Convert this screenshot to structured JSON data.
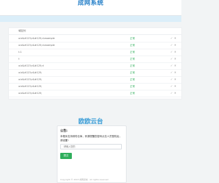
{
  "header": {
    "title": "成网系统"
  },
  "table": {
    "column_header": "域名列",
    "rows": [
      {
        "name": "a.b&#123;c&#125;d.example",
        "status": "正常",
        "actions": [
          "✓",
          "✕"
        ]
      },
      {
        "name": "a.b&#123;c&#125;d.example",
        "status": "正常",
        "actions": [
          "✓",
          "✕"
        ]
      },
      {
        "name": "t.1",
        "status": "正常",
        "actions": [
          "✓",
          "✕"
        ]
      },
      {
        "name": "t",
        "status": "正常",
        "actions": [
          "✓",
          "✕"
        ]
      },
      {
        "name": "a.b&#123;c&#125;d",
        "status": "正常",
        "actions": [
          "✓",
          "✕"
        ]
      },
      {
        "name": "a.b&#123;c&#125;",
        "status": "正常",
        "actions": [
          "✓",
          "✕"
        ]
      },
      {
        "name": "a.b&#123;c&#125;",
        "status": "正常",
        "actions": [
          "✓",
          "✕"
        ]
      },
      {
        "name": "a.b&#123;c&#125;",
        "status": "正常",
        "actions": [
          "✓",
          "✕"
        ]
      },
      {
        "name": "a.b&#123;c&#125;",
        "status": "正常",
        "actions": [
          "✓",
          "✕"
        ]
      }
    ]
  },
  "logo_text": "欧欧云台",
  "card": {
    "title": "公告:",
    "text": "本程序支持修改仓库，来源提醒您密码点击人员登陆后，请设置!",
    "input_placeholder": "请输入您的",
    "submit_label": "提交",
    "footer": "Copyright © 2023 成网系统 · All rights reserved"
  },
  "colors": {
    "accent": "#2a82c9",
    "success": "#2fae5c",
    "info_bar": "#dbeef9"
  }
}
